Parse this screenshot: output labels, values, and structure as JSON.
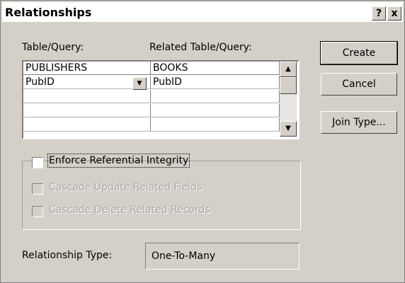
{
  "window": {
    "title": "Relationships",
    "help_button": "?",
    "close_button": "x"
  },
  "grid": {
    "left_header_label": "Table/Query:",
    "right_header_label": "Related Table/Query:",
    "left_table": "PUBLISHERS",
    "right_table": "BOOKS",
    "rows": [
      {
        "left": "PubID",
        "right": "PubID"
      },
      {
        "left": "",
        "right": ""
      },
      {
        "left": "",
        "right": ""
      },
      {
        "left": "",
        "right": ""
      }
    ]
  },
  "buttons": {
    "create": "Create",
    "cancel": "Cancel",
    "join_type": "Join Type..."
  },
  "options": {
    "enforce_ri": {
      "label": "Enforce Referential Integrity",
      "checked": false
    },
    "cascade_update": {
      "label": "Cascade Update Related Fields",
      "checked": false,
      "enabled": false
    },
    "cascade_delete": {
      "label": "Cascade Delete Related Records",
      "checked": false,
      "enabled": false
    }
  },
  "relationship": {
    "label": "Relationship Type:",
    "value": "One-To-Many"
  }
}
